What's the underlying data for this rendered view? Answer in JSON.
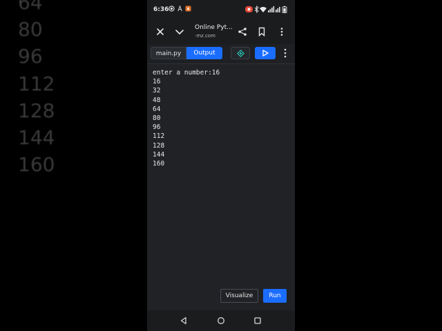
{
  "background": {
    "numbers": [
      "64",
      "80",
      "96",
      "112",
      "128",
      "144",
      "160"
    ]
  },
  "status_bar": {
    "time": "6:36"
  },
  "browser": {
    "page_title": "Online Pyt...",
    "page_url": "·mz.com"
  },
  "toolbar": {
    "tab_main": "main.py",
    "tab_output": "Output"
  },
  "console": {
    "lines": [
      "enter a number:16",
      "16",
      "32",
      "48",
      "64",
      "80",
      "96",
      "112",
      "128",
      "144",
      "160"
    ]
  },
  "actions": {
    "visualize": "Visualize",
    "run": "Run"
  },
  "colors": {
    "accent": "#1a6dff",
    "panel": "#202226",
    "status_red": "#e84a3a",
    "status_orange": "#e0732a"
  }
}
